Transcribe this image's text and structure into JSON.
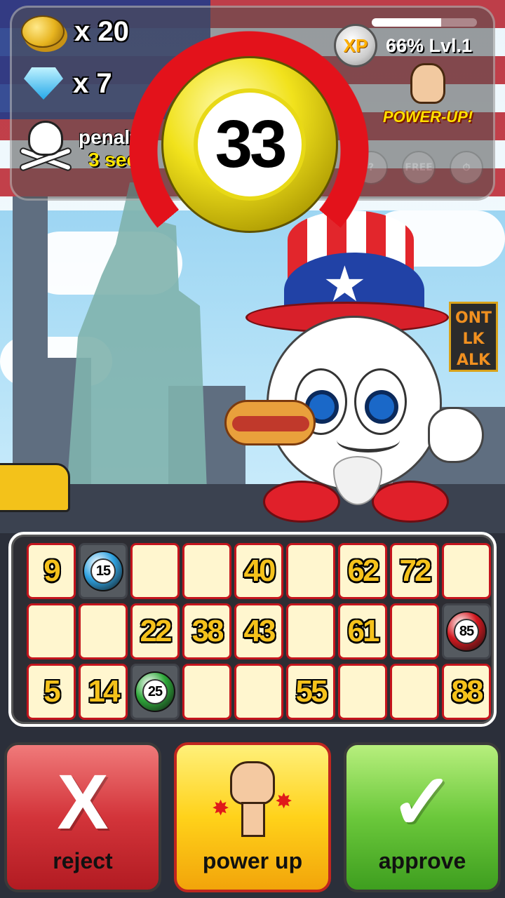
{
  "hud": {
    "coins": "x 20",
    "gems": "x 7",
    "penalty_label": "penalty",
    "penalty_time": "3 sec",
    "xp_badge": "XP",
    "xp_progress": 0.66,
    "xp_text": "66%  Lvl.1",
    "powerup_label": "POWER-UP!",
    "mini_icons": [
      "?",
      "FREE",
      "⏱"
    ]
  },
  "current_ball": "33",
  "card": {
    "rows": [
      [
        {
          "v": "9"
        },
        {
          "v": "15",
          "ball": "#2fa2e0"
        },
        {
          "v": ""
        },
        {
          "v": ""
        },
        {
          "v": "40"
        },
        {
          "v": ""
        },
        {
          "v": "62"
        },
        {
          "v": "72"
        },
        {
          "v": ""
        }
      ],
      [
        {
          "v": ""
        },
        {
          "v": ""
        },
        {
          "v": "22"
        },
        {
          "v": "38"
        },
        {
          "v": "43"
        },
        {
          "v": ""
        },
        {
          "v": "61"
        },
        {
          "v": ""
        },
        {
          "v": "85",
          "ball": "#d3181f"
        }
      ],
      [
        {
          "v": "5"
        },
        {
          "v": "14"
        },
        {
          "v": "25",
          "ball": "#2ea83a"
        },
        {
          "v": ""
        },
        {
          "v": ""
        },
        {
          "v": "55"
        },
        {
          "v": ""
        },
        {
          "v": ""
        },
        {
          "v": "88"
        }
      ]
    ]
  },
  "buttons": {
    "reject_glyph": "X",
    "reject_label": "reject",
    "power_label": "power up",
    "approve_glyph": "✓",
    "approve_label": "approve"
  },
  "colors": {
    "accent_red": "#d3343a",
    "accent_yellow": "#ffd21a",
    "accent_green": "#6bc83b"
  }
}
